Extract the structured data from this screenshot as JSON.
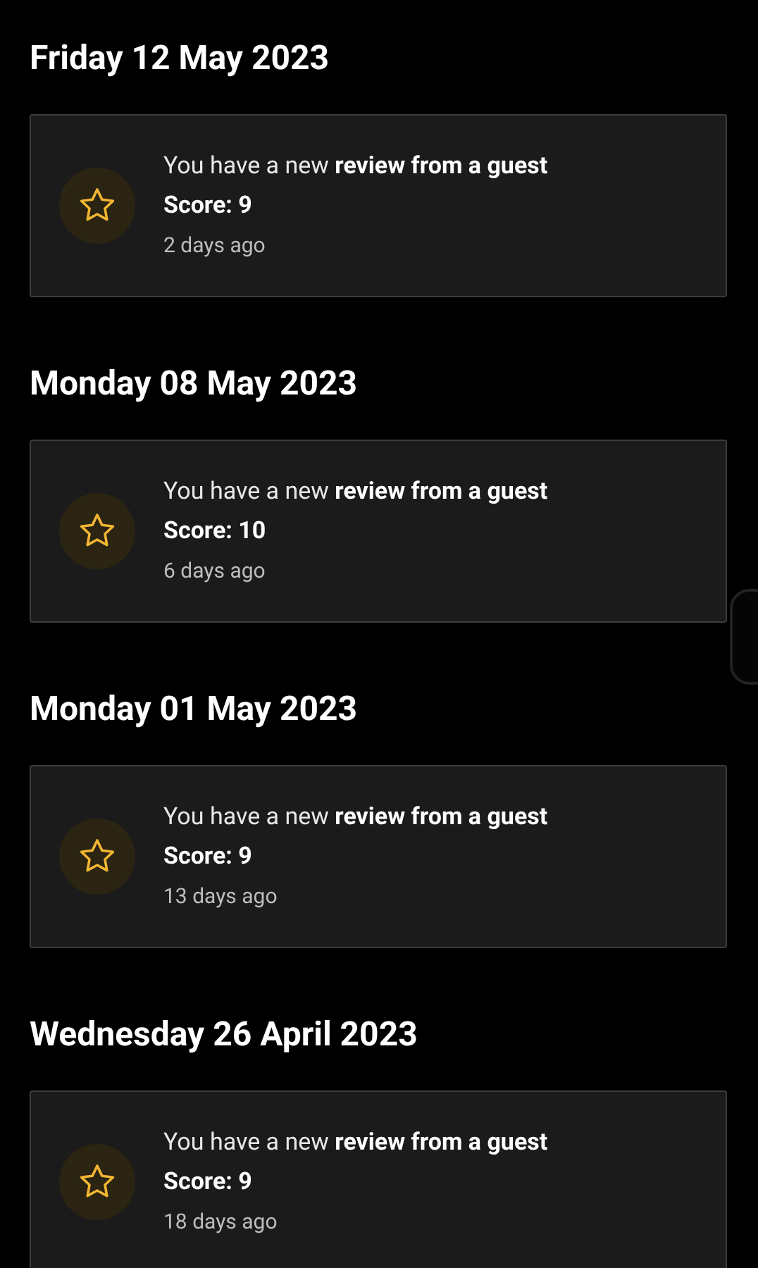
{
  "groups": [
    {
      "date": "Friday 12 May 2023",
      "notifications": [
        {
          "message": "You have a new **review from a guest**",
          "score": "Score: 9",
          "time": "2 days ago"
        }
      ]
    },
    {
      "date": "Monday 08 May 2023",
      "notifications": [
        {
          "message": "You have a new **review from a guest**",
          "score": "Score: 10",
          "time": "6 days ago"
        }
      ]
    },
    {
      "date": "Monday 01 May 2023",
      "notifications": [
        {
          "message": "You have a new **review from a guest**",
          "score": "Score: 9",
          "time": "13 days ago"
        }
      ]
    },
    {
      "date": "Wednesday 26 April 2023",
      "notifications": [
        {
          "message": "You have a new **review from a guest**",
          "score": "Score: 9",
          "time": "18 days ago"
        }
      ]
    }
  ]
}
